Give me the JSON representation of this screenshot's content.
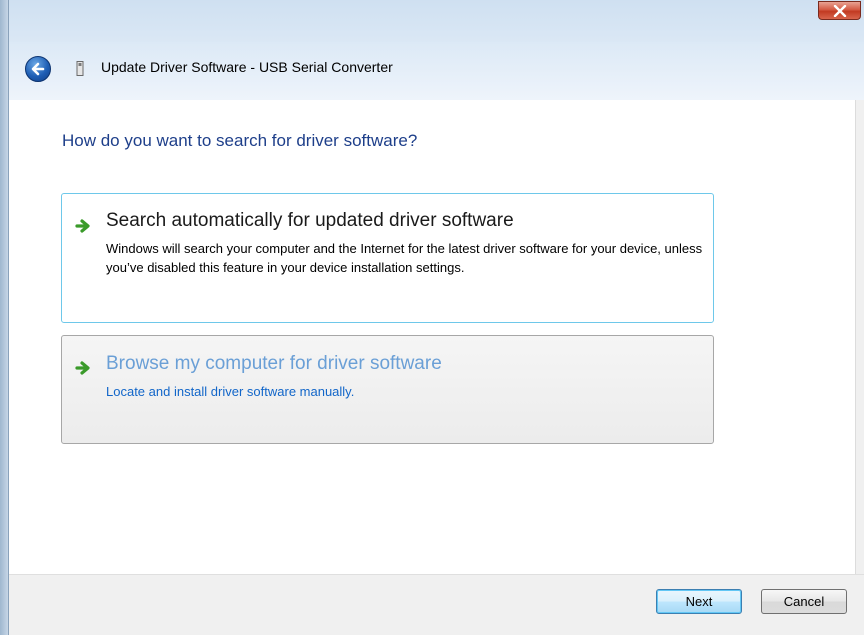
{
  "window": {
    "title": "Update Driver Software - USB Serial Converter",
    "close_icon": "close-icon",
    "back_icon": "back-arrow-icon",
    "device_icon": "usb-device-icon"
  },
  "content": {
    "question": "How do you want to search for driver software?",
    "options": [
      {
        "title": "Search automatically for updated driver software",
        "description": "Windows will search your computer and the Internet for the latest driver software for your device, unless you’ve disabled this feature in your device installation settings.",
        "icon": "green-arrow-icon",
        "state": "hover"
      },
      {
        "title": "Browse my computer for driver software",
        "description": "Locate and install driver software manually.",
        "icon": "green-arrow-icon",
        "state": "normal"
      }
    ]
  },
  "footer": {
    "next_label": "Next",
    "cancel_label": "Cancel"
  },
  "colors": {
    "question_text": "#1e3f8a",
    "link_blue": "#1266c9",
    "hover_border": "#6ec8ea",
    "close_red": "#c23a22"
  }
}
